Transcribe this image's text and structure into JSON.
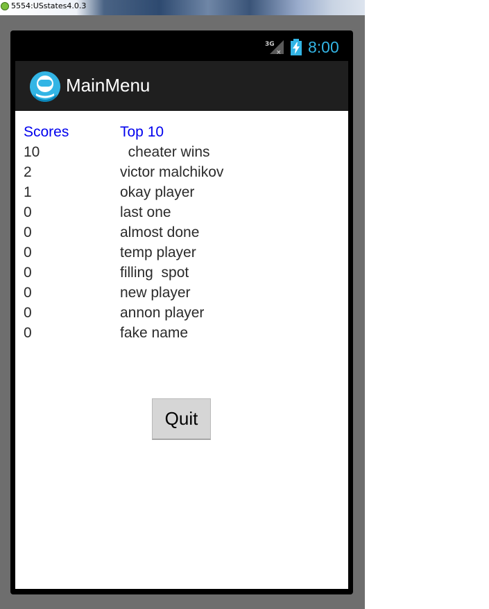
{
  "window": {
    "title": "5554:USstates4.0.3",
    "icon": "android-emulator-icon"
  },
  "status_bar": {
    "network": "3G",
    "time": "8:00",
    "signal_icon": "signal-3g-icon",
    "battery_icon": "battery-charging-icon",
    "accent_color": "#33b5e5"
  },
  "action_bar": {
    "title": "MainMenu",
    "logo_icon": "app-logo-icon"
  },
  "scoreboard": {
    "score_header": "Scores",
    "name_header": "Top 10",
    "rows": [
      {
        "score": "10",
        "name": "  cheater wins"
      },
      {
        "score": "2",
        "name": "victor malchikov"
      },
      {
        "score": "1",
        "name": "okay player"
      },
      {
        "score": "0",
        "name": "last one"
      },
      {
        "score": "0",
        "name": "almost done"
      },
      {
        "score": "0",
        "name": "temp player"
      },
      {
        "score": "0",
        "name": "filling  spot"
      },
      {
        "score": "0",
        "name": "new player"
      },
      {
        "score": "0",
        "name": "annon player"
      },
      {
        "score": "0",
        "name": "fake name"
      }
    ]
  },
  "quit_button": {
    "label": "Quit"
  },
  "colors": {
    "header_text": "#0000ee",
    "action_bar": "#1f1f1f",
    "button": "#d6d6d6"
  }
}
